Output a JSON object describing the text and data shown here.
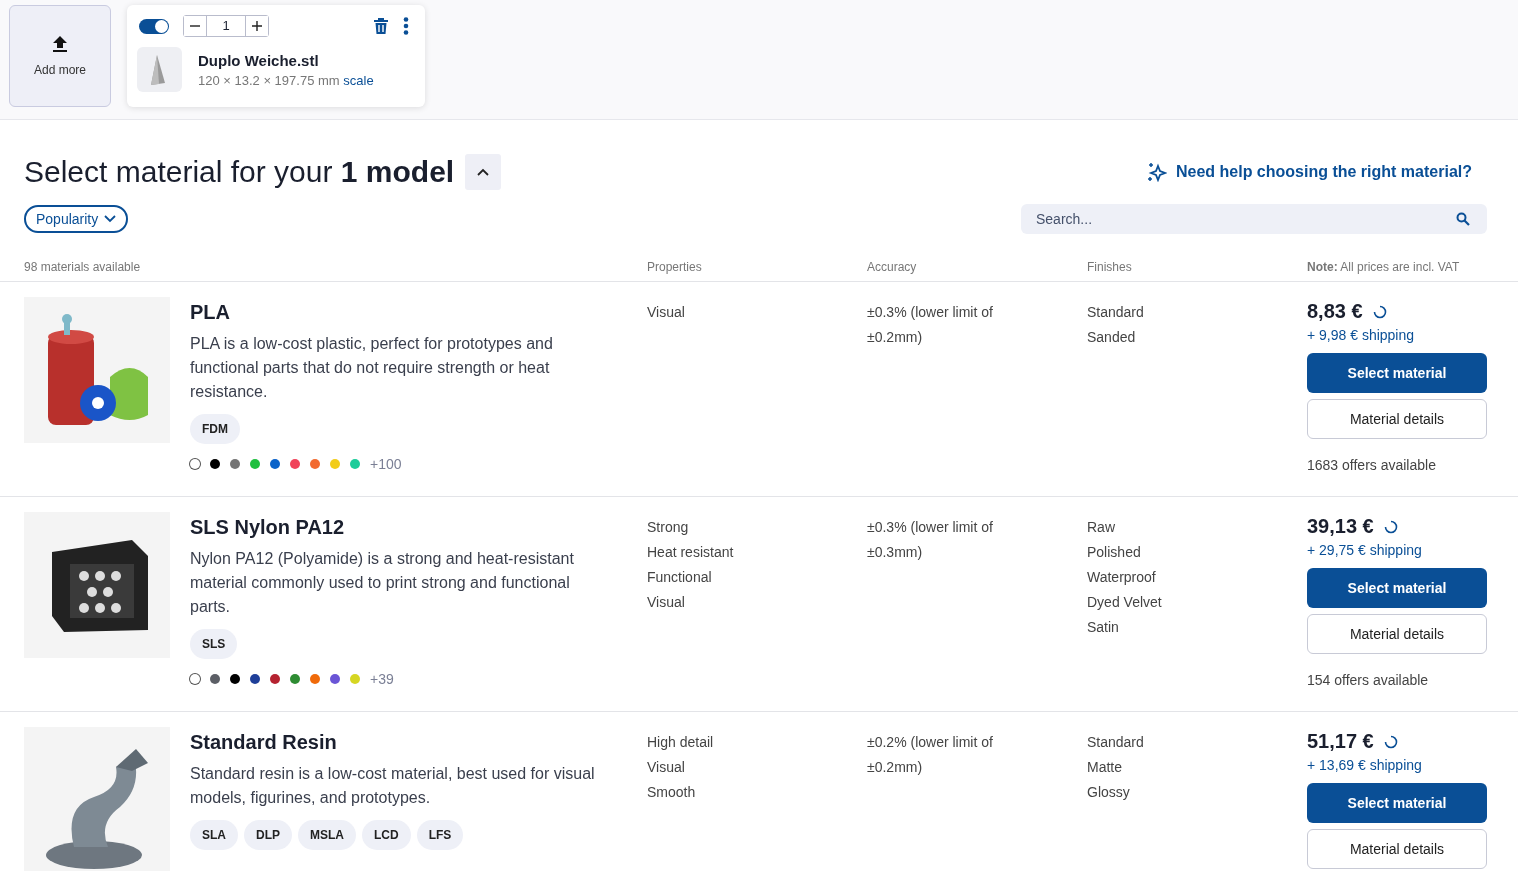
{
  "upload": {
    "add_more": "Add more"
  },
  "model_card": {
    "enabled": true,
    "quantity": "1",
    "file_name": "Duplo Weiche.stl",
    "dimensions": "120 × 13.2 × 197.75 mm",
    "scale_link": "scale"
  },
  "heading": {
    "title": "Select material for your **1 model**",
    "collapsed": false,
    "help_link": "Need help choosing the right material?"
  },
  "sort": {
    "value": "Popularity"
  },
  "search": {
    "placeholder": "Search..."
  },
  "table": {
    "count": "98 materials available",
    "columns": [
      "Properties",
      "Accuracy",
      "Finishes"
    ],
    "note_label": "Note:",
    "note": "All prices are incl. VAT",
    "rows": [
      {
        "name": "PLA",
        "description": "PLA is a low-cost plastic, perfect for prototypes and functional parts that do not require strength or heat resistance.",
        "technologies": [
          "FDM"
        ],
        "swatches": [
          {
            "color": "#ffffff"
          },
          {
            "color": "#000000"
          },
          {
            "color": "#757575"
          },
          {
            "color": "#1fbf3f"
          },
          {
            "color": "#0a63c9"
          },
          {
            "color": "#f0435a"
          },
          {
            "color": "#f26a30"
          },
          {
            "color": "#f2cc1a"
          },
          {
            "color": "#1ccc9a"
          }
        ],
        "more_colors": "+100",
        "properties": [
          "Visual"
        ],
        "accuracy": "±0.3% (lower limit of ±0.2mm)",
        "finishes": [
          "Standard",
          "Sanded"
        ],
        "price": "8,83 €",
        "shipping": "+ 9,98 € shipping",
        "select_button": "Select material",
        "details_button": "Material details",
        "offers": "1683 offers available",
        "kind": "pla"
      },
      {
        "name": "SLS Nylon PA12",
        "description": "Nylon PA12 (Polyamide) is a strong and heat-resistant material commonly used to print strong and functional parts.",
        "technologies": [
          "SLS"
        ],
        "swatches": [
          {
            "color": "#ffffff"
          },
          {
            "color": "#5c5f66"
          },
          {
            "color": "#000000"
          },
          {
            "color": "#1f3f99"
          },
          {
            "color": "#b52230"
          },
          {
            "color": "#2e8c33"
          },
          {
            "color": "#f06a0a"
          },
          {
            "color": "#6a55d6"
          },
          {
            "color": "#d6d622"
          }
        ],
        "more_colors": "+39",
        "properties": [
          "Strong",
          "Heat resistant",
          "Functional",
          "Visual"
        ],
        "accuracy": "±0.3% (lower limit of ±0.3mm)",
        "finishes": [
          "Raw",
          "Polished",
          "Waterproof",
          "Dyed Velvet",
          "Satin"
        ],
        "price": "39,13 €",
        "shipping": "+ 29,75 € shipping",
        "select_button": "Select material",
        "details_button": "Material details",
        "offers": "154 offers available",
        "kind": "nylon"
      },
      {
        "name": "Standard Resin",
        "description": "Standard resin is a low-cost material, best used for visual models, figurines, and prototypes.",
        "technologies": [
          "SLA",
          "DLP",
          "MSLA",
          "LCD",
          "LFS"
        ],
        "properties": [
          "High detail",
          "Visual",
          "Smooth"
        ],
        "accuracy": "±0.2% (lower limit of ±0.2mm)",
        "finishes": [
          "Standard",
          "Matte",
          "Glossy"
        ],
        "price": "51,17 €",
        "shipping": "+ 13,69 € shipping",
        "select_button": "Select material",
        "details_button": "Material details",
        "kind": "resin"
      }
    ]
  }
}
